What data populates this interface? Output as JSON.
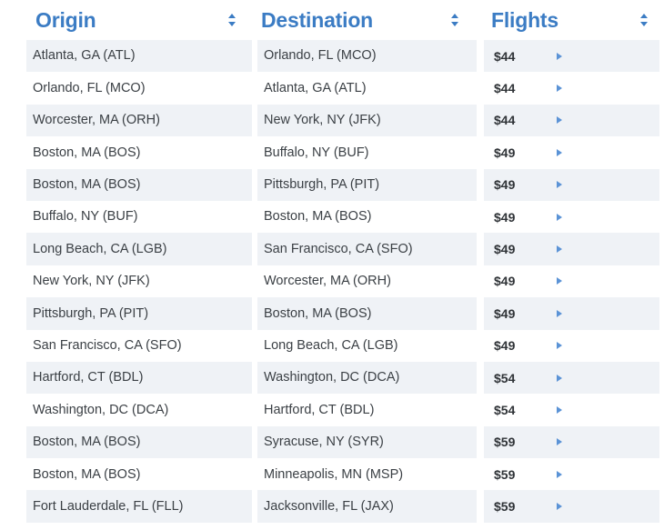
{
  "table": {
    "columns": [
      {
        "key": "origin",
        "label": "Origin",
        "sort_icon": "sort-updown-icon",
        "sortable": true
      },
      {
        "key": "destination",
        "label": "Destination",
        "sort_icon": "sort-updown-icon",
        "sortable": true
      },
      {
        "key": "flights",
        "label": "Flights",
        "sort_icon": "sort-updown-icon",
        "sortable": true
      }
    ],
    "row_expand_icon": "caret-right-icon",
    "colors": {
      "header_text": "#3b7cc4",
      "row_stripe": "#eff2f6",
      "row_plain": "#ffffff",
      "cell_text": "#3b4045",
      "price_text": "#2f3337",
      "caret": "#5b93d6",
      "sort_icon": "#3b7cc4"
    },
    "rows": [
      {
        "origin": "Atlanta, GA (ATL)",
        "destination": "Orlando, FL (MCO)",
        "price": "$44"
      },
      {
        "origin": "Orlando, FL (MCO)",
        "destination": "Atlanta, GA (ATL)",
        "price": "$44"
      },
      {
        "origin": "Worcester, MA (ORH)",
        "destination": "New York, NY (JFK)",
        "price": "$44"
      },
      {
        "origin": "Boston, MA (BOS)",
        "destination": "Buffalo, NY (BUF)",
        "price": "$49"
      },
      {
        "origin": "Boston, MA (BOS)",
        "destination": "Pittsburgh, PA (PIT)",
        "price": "$49"
      },
      {
        "origin": "Buffalo, NY (BUF)",
        "destination": "Boston, MA (BOS)",
        "price": "$49"
      },
      {
        "origin": "Long Beach, CA (LGB)",
        "destination": "San Francisco, CA (SFO)",
        "price": "$49"
      },
      {
        "origin": "New York, NY (JFK)",
        "destination": "Worcester, MA (ORH)",
        "price": "$49"
      },
      {
        "origin": "Pittsburgh, PA (PIT)",
        "destination": "Boston, MA (BOS)",
        "price": "$49"
      },
      {
        "origin": "San Francisco, CA (SFO)",
        "destination": "Long Beach, CA (LGB)",
        "price": "$49"
      },
      {
        "origin": "Hartford, CT (BDL)",
        "destination": "Washington, DC (DCA)",
        "price": "$54"
      },
      {
        "origin": "Washington, DC (DCA)",
        "destination": "Hartford, CT (BDL)",
        "price": "$54"
      },
      {
        "origin": "Boston, MA (BOS)",
        "destination": "Syracuse, NY (SYR)",
        "price": "$59"
      },
      {
        "origin": "Boston, MA (BOS)",
        "destination": "Minneapolis, MN (MSP)",
        "price": "$59"
      },
      {
        "origin": "Fort Lauderdale, FL (FLL)",
        "destination": "Jacksonville, FL (JAX)",
        "price": "$59"
      }
    ]
  }
}
